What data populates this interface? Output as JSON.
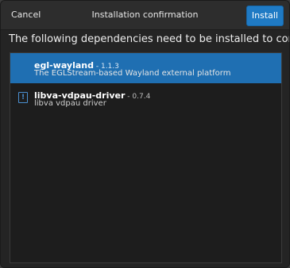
{
  "header": {
    "cancel_label": "Cancel",
    "title": "Installation confirmation",
    "install_label": "Install"
  },
  "message": "The following dependencies need to be installed to continue",
  "dependencies": [
    {
      "name": "egl-wayland",
      "version": " - 1.1.3",
      "description": "The EGLStream-based Wayland external platform",
      "selected": true,
      "icon": "none"
    },
    {
      "name": "libva-vdpau-driver",
      "version": " - 0.7.4",
      "description": "libva vdpau driver",
      "selected": false,
      "icon": "info-icon"
    }
  ],
  "colors": {
    "accent": "#1f6fb2",
    "install_button": "#1f7ac4"
  }
}
